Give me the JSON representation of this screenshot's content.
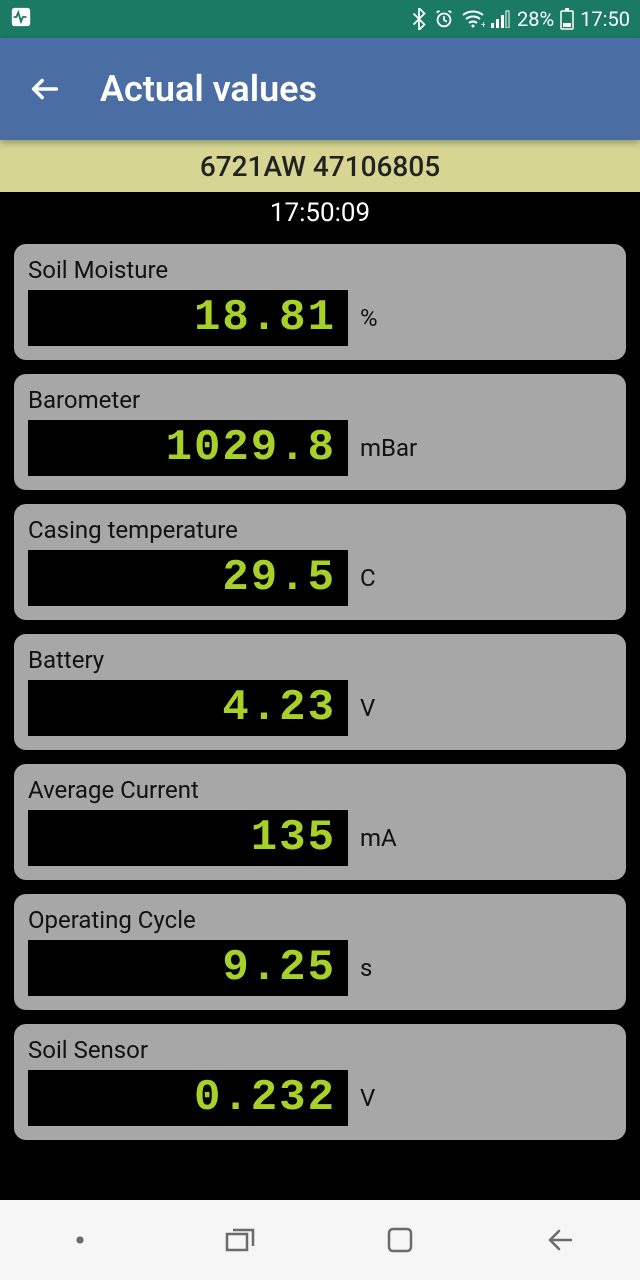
{
  "statusbar": {
    "battery_pct": "28%",
    "clock": "17:50"
  },
  "appbar": {
    "title": "Actual values"
  },
  "device_banner": "6721AW 47106805",
  "timestamp": "17:50:09",
  "readings": [
    {
      "label": "Soil Moisture",
      "value": "18.81",
      "unit": "%"
    },
    {
      "label": "Barometer",
      "value": "1029.8",
      "unit": "mBar"
    },
    {
      "label": "Casing temperature",
      "value": "29.5",
      "unit": "C"
    },
    {
      "label": "Battery",
      "value": "4.23",
      "unit": "V"
    },
    {
      "label": "Average Current",
      "value": "135",
      "unit": "mA"
    },
    {
      "label": "Operating Cycle",
      "value": "9.25",
      "unit": "s"
    },
    {
      "label": "Soil Sensor",
      "value": "0.232",
      "unit": "V"
    }
  ]
}
